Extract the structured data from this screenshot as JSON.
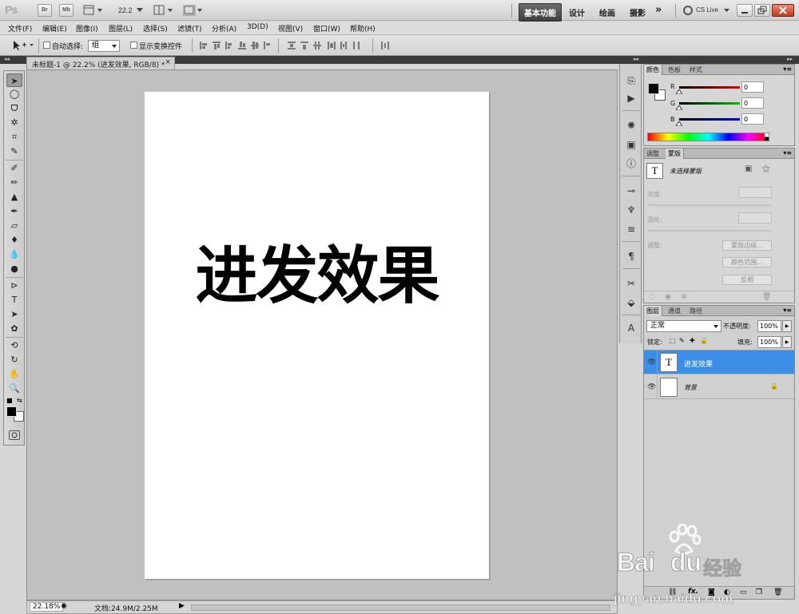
{
  "appbar": {
    "logo": "Ps",
    "btn_br": "Br",
    "btn_mb": "Mb",
    "zoom": "22.2",
    "workspaces": [
      "基本功能",
      "设计",
      "绘画",
      "摄影"
    ],
    "more": "»",
    "cslive": "CS Live"
  },
  "menu": [
    "文件(F)",
    "编辑(E)",
    "图像(I)",
    "图层(L)",
    "选择(S)",
    "滤镜(T)",
    "分析(A)",
    "3D(D)",
    "视图(V)",
    "窗口(W)",
    "帮助(H)"
  ],
  "options": {
    "auto_select_label": "自动选择:",
    "auto_select_value": "组",
    "show_transform_label": "显示变换控件"
  },
  "document": {
    "tab_title": "未标题-1 @ 22.2% (进发效果, RGB/8) *",
    "canvas_text": "进发效果"
  },
  "status": {
    "zoom": "22.18%",
    "doc_size": "文档:24.9M/2.25M"
  },
  "color_panel": {
    "tabs": [
      "颜色",
      "色板",
      "样式"
    ],
    "channels": [
      {
        "name": "R",
        "value": "0",
        "color": "#e00000"
      },
      {
        "name": "G",
        "value": "0",
        "color": "#00c000"
      },
      {
        "name": "B",
        "value": "0",
        "color": "#0000d0"
      }
    ]
  },
  "adjust_panel": {
    "tabs": [
      "调整",
      "蒙版"
    ],
    "no_mask": "未选择蒙版",
    "density_label": "浓度:",
    "feather_label": "羽化:",
    "adjust_label": "调整:",
    "btn_mask_edge": "蒙版边缘...",
    "btn_color_range": "颜色范围...",
    "btn_invert": "反相"
  },
  "layers_panel": {
    "tabs": [
      "图层",
      "通道",
      "路径"
    ],
    "blend_mode": "正常",
    "opacity_label": "不透明度:",
    "opacity_value": "100%",
    "lock_label": "锁定:",
    "fill_label": "填充:",
    "fill_value": "100%",
    "layers": [
      {
        "name": "进发效果",
        "thumb": "T"
      },
      {
        "name": "背景",
        "thumb": ""
      }
    ]
  },
  "watermark": {
    "brand": "Bai",
    "brand2": "du",
    "brand_cn": "经验",
    "url": "jingyan.baidu.com"
  }
}
